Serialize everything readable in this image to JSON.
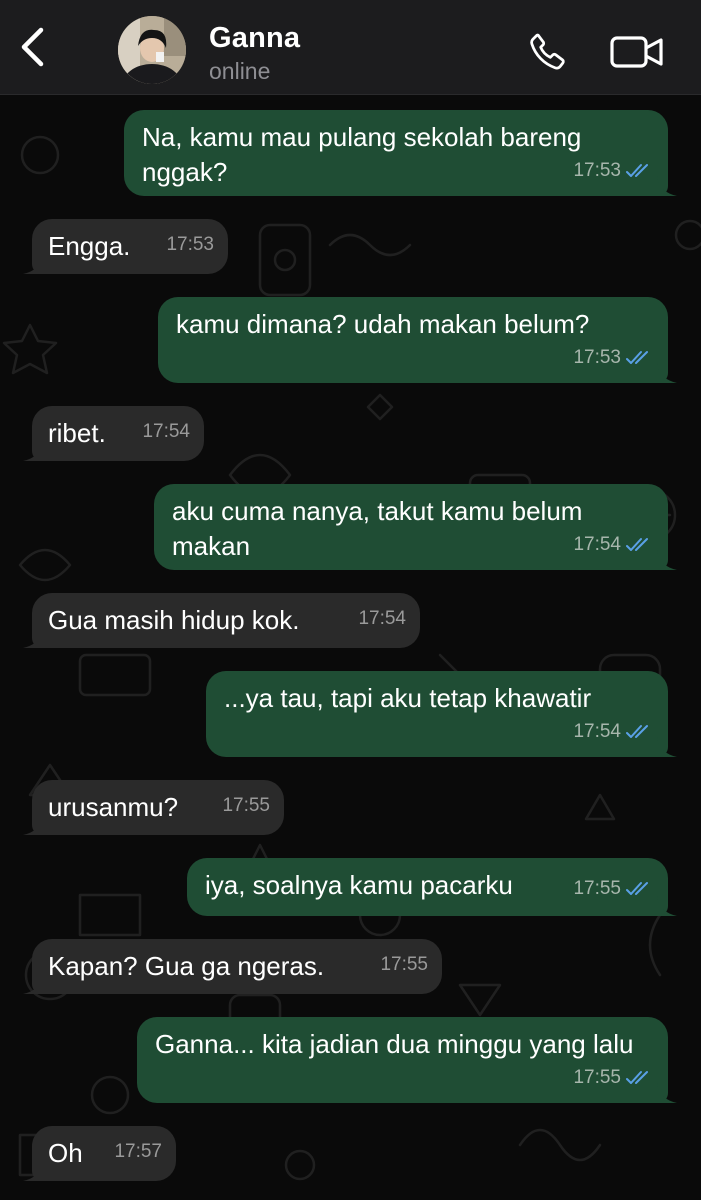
{
  "header": {
    "back_icon": "chevron-left-icon",
    "contact_name": "Ganna",
    "contact_status": "online",
    "call_icon": "phone-icon",
    "video_icon": "video-camera-icon"
  },
  "colors": {
    "outgoing_bubble": "#1f4d34",
    "incoming_bubble": "#2a2a2a",
    "read_ticks": "#5aa0e6",
    "header_bg": "#1c1c1e"
  },
  "messages": [
    {
      "direction": "out",
      "text": "Na, kamu mau pulang sekolah bareng nggak?",
      "time": "17:53",
      "status": "read"
    },
    {
      "direction": "in",
      "text": "Engga.",
      "time": "17:53"
    },
    {
      "direction": "out",
      "text": "kamu dimana? udah makan belum?",
      "time": "17:53",
      "status": "read"
    },
    {
      "direction": "in",
      "text": "ribet.",
      "time": "17:54"
    },
    {
      "direction": "out",
      "text": "aku cuma nanya, takut kamu belum makan",
      "time": "17:54",
      "status": "read"
    },
    {
      "direction": "in",
      "text": "Gua masih hidup kok.",
      "time": "17:54"
    },
    {
      "direction": "out",
      "text": "...ya tau, tapi aku tetap khawatir",
      "time": "17:54",
      "status": "read"
    },
    {
      "direction": "in",
      "text": "urusanmu?",
      "time": "17:55"
    },
    {
      "direction": "out",
      "text": "iya, soalnya kamu pacarku",
      "time": "17:55",
      "status": "read"
    },
    {
      "direction": "in",
      "text": "Kapan? Gua ga ngeras.",
      "time": "17:55"
    },
    {
      "direction": "out",
      "text": "Ganna... kita jadian dua minggu yang lalu",
      "time": "17:55",
      "status": "read"
    },
    {
      "direction": "in",
      "text": "Oh",
      "time": "17:57"
    }
  ]
}
